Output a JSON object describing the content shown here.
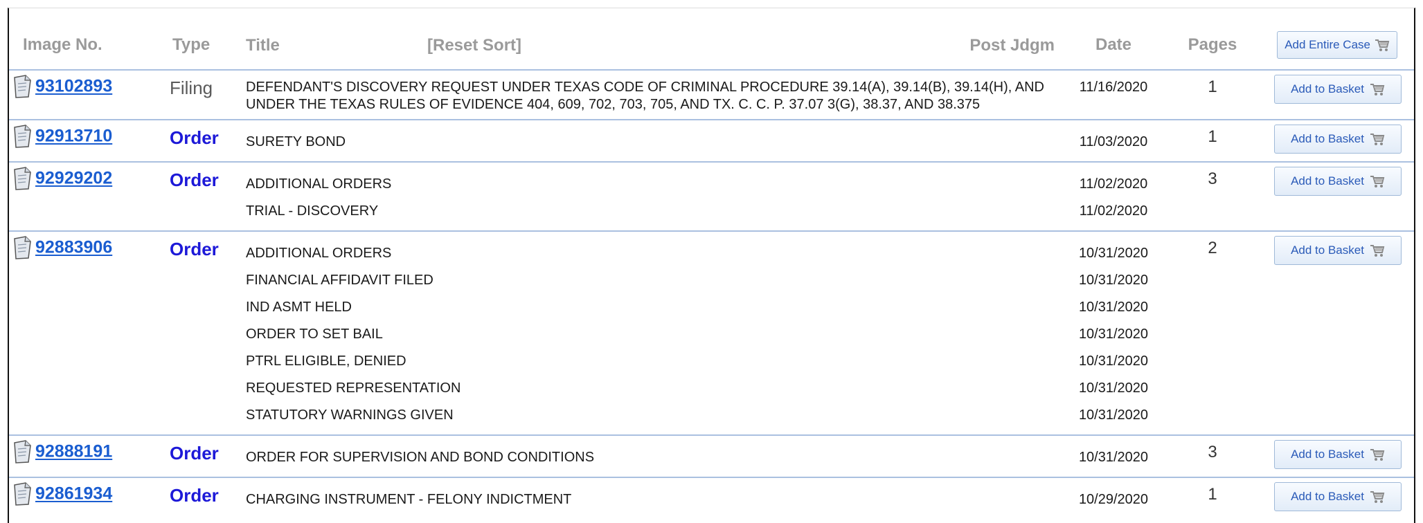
{
  "header": {
    "image_no": "Image No.",
    "type": "Type",
    "title": "Title",
    "reset_sort": "[Reset Sort]",
    "post_jdgm": "Post Jdgm",
    "date": "Date",
    "pages": "Pages",
    "add_entire_case": "Add Entire Case"
  },
  "add_to_basket_label": "Add to Basket",
  "rows": [
    {
      "image_no": "93102893",
      "type": "Filing",
      "titles": [
        "DEFENDANT'S DISCOVERY REQUEST UNDER TEXAS CODE OF CRIMINAL PROCEDURE 39.14(A), 39.14(B), 39.14(H), AND UNDER THE TEXAS RULES OF EVIDENCE 404, 609, 702, 703, 705, AND TX. C. C. P. 37.07 3(G), 38.37, AND 38.375"
      ],
      "dates": [
        "11/16/2020"
      ],
      "pages": "1"
    },
    {
      "image_no": "92913710",
      "type": "Order",
      "titles": [
        "SURETY BOND"
      ],
      "dates": [
        "11/03/2020"
      ],
      "pages": "1"
    },
    {
      "image_no": "92929202",
      "type": "Order",
      "titles": [
        "ADDITIONAL ORDERS",
        "TRIAL - DISCOVERY"
      ],
      "dates": [
        "11/02/2020",
        "11/02/2020"
      ],
      "pages": "3"
    },
    {
      "image_no": "92883906",
      "type": "Order",
      "titles": [
        "ADDITIONAL ORDERS",
        "FINANCIAL AFFIDAVIT FILED",
        "IND ASMT HELD",
        "ORDER TO SET BAIL",
        "PTRL ELIGIBLE, DENIED",
        "REQUESTED REPRESENTATION",
        "STATUTORY WARNINGS GIVEN"
      ],
      "dates": [
        "10/31/2020",
        "10/31/2020",
        "10/31/2020",
        "10/31/2020",
        "10/31/2020",
        "10/31/2020",
        "10/31/2020"
      ],
      "pages": "2"
    },
    {
      "image_no": "92888191",
      "type": "Order",
      "titles": [
        "ORDER FOR SUPERVISION AND BOND CONDITIONS"
      ],
      "dates": [
        "10/31/2020"
      ],
      "pages": "3"
    },
    {
      "image_no": "92861934",
      "type": "Order",
      "titles": [
        "CHARGING INSTRUMENT - FELONY INDICTMENT"
      ],
      "dates": [
        "10/29/2020"
      ],
      "pages": "1"
    }
  ],
  "icons": {
    "document": "document-icon",
    "cart": "cart-icon"
  },
  "colors": {
    "link": "#1a5dd0",
    "order_type": "#1d19d8",
    "header_text": "#9a9a9a",
    "row_border": "#aac0e0"
  }
}
